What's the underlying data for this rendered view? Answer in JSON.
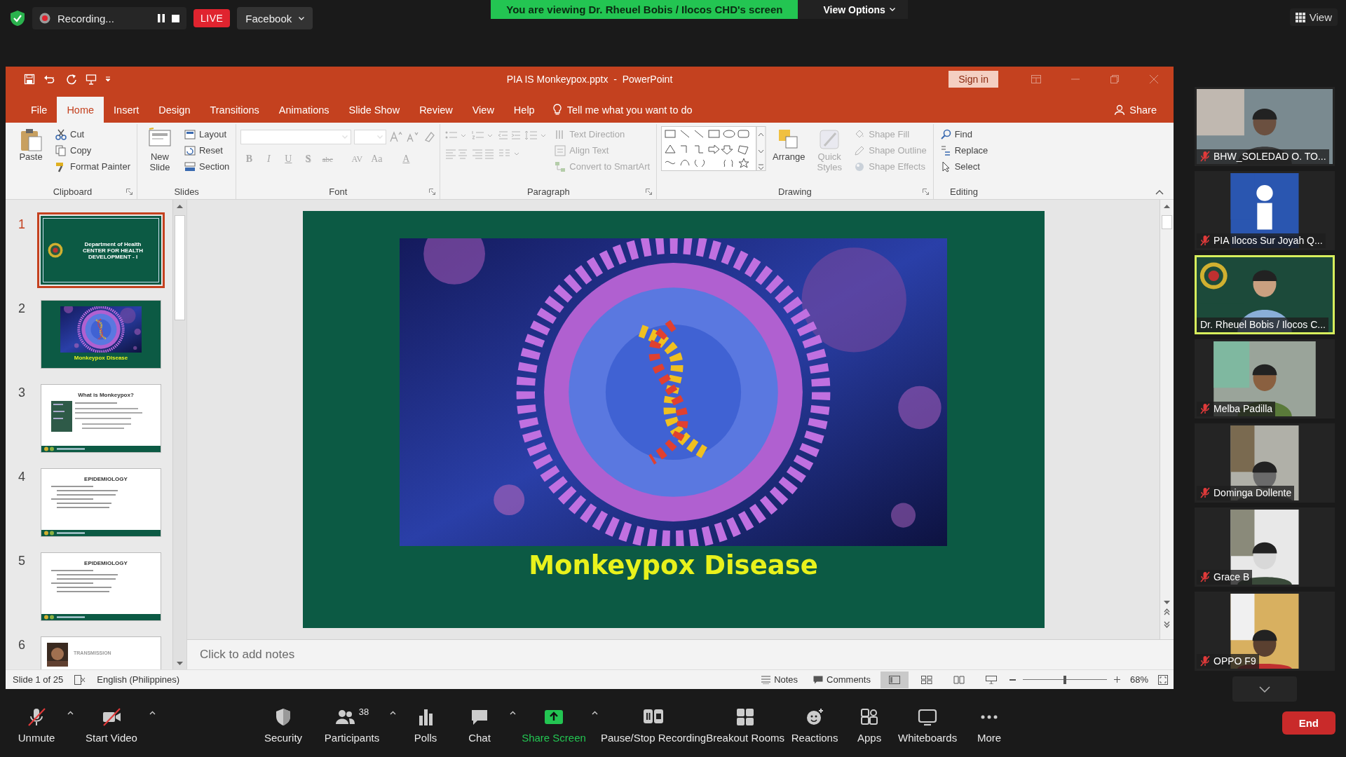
{
  "meeting_bar": {
    "recording": "Recording...",
    "live_badge": "LIVE",
    "stream_target": "Facebook",
    "banner": "You are viewing Dr. Rheuel Bobis / Ilocos CHD's screen",
    "view_options": "View Options",
    "view_button": "View"
  },
  "powerpoint": {
    "title": "PIA IS Monkeypox.pptx  -  PowerPoint",
    "sign_in": "Sign in",
    "tabs": [
      {
        "label": "File",
        "selected": false
      },
      {
        "label": "Home",
        "selected": true
      },
      {
        "label": "Insert",
        "selected": false
      },
      {
        "label": "Design",
        "selected": false
      },
      {
        "label": "Transitions",
        "selected": false
      },
      {
        "label": "Animations",
        "selected": false
      },
      {
        "label": "Slide Show",
        "selected": false
      },
      {
        "label": "Review",
        "selected": false
      },
      {
        "label": "View",
        "selected": false
      },
      {
        "label": "Help",
        "selected": false
      }
    ],
    "tell_me": "Tell me what you want to do",
    "share": "Share",
    "ribbon_groups": [
      {
        "label": "Clipboard",
        "launcher": true,
        "items": [
          {
            "label": "Paste",
            "kind": "large",
            "disabled": false
          },
          {
            "label": "Cut",
            "kind": "small",
            "disabled": false
          },
          {
            "label": "Copy",
            "kind": "small",
            "disabled": false
          },
          {
            "label": "Format Painter",
            "kind": "small",
            "disabled": false
          }
        ]
      },
      {
        "label": "Slides",
        "launcher": false,
        "items": [
          {
            "label": "New Slide",
            "kind": "large",
            "disabled": false
          },
          {
            "label": "Layout",
            "kind": "small",
            "disabled": false
          },
          {
            "label": "Reset",
            "kind": "small",
            "disabled": false
          },
          {
            "label": "Section",
            "kind": "small",
            "disabled": false
          }
        ]
      },
      {
        "label": "Font",
        "launcher": true,
        "items": [
          {
            "kind": "field",
            "disabled": true
          },
          {
            "kind": "field",
            "disabled": true
          },
          {
            "label": "B",
            "kind": "glyph",
            "disabled": true
          },
          {
            "label": "I",
            "kind": "glyph",
            "disabled": true
          },
          {
            "label": "U",
            "kind": "glyph",
            "disabled": true
          },
          {
            "label": "S",
            "kind": "glyph",
            "disabled": true
          },
          {
            "label": "abc",
            "kind": "glyph",
            "disabled": true
          },
          {
            "label": "AV",
            "kind": "glyph",
            "disabled": true
          },
          {
            "label": "Aa",
            "kind": "glyph",
            "disabled": true
          },
          {
            "label": "A",
            "kind": "glyph",
            "disabled": true
          }
        ]
      },
      {
        "label": "Paragraph",
        "launcher": true,
        "items": [
          {
            "label": "Text Direction",
            "kind": "small",
            "disabled": true
          },
          {
            "label": "Align Text",
            "kind": "small",
            "disabled": true
          },
          {
            "label": "Convert to SmartArt",
            "kind": "small",
            "disabled": true
          }
        ]
      },
      {
        "label": "Drawing",
        "launcher": true,
        "items": [
          {
            "label": "Arrange",
            "kind": "large",
            "disabled": false
          },
          {
            "label": "Quick Styles",
            "kind": "large",
            "disabled": true
          },
          {
            "label": "Shape Fill",
            "kind": "small",
            "disabled": true
          },
          {
            "label": "Shape Outline",
            "kind": "small",
            "disabled": true
          },
          {
            "label": "Shape Effects",
            "kind": "small",
            "disabled": true
          }
        ]
      },
      {
        "label": "Editing",
        "launcher": false,
        "items": [
          {
            "label": "Find",
            "kind": "small",
            "disabled": false
          },
          {
            "label": "Replace",
            "kind": "small",
            "disabled": false
          },
          {
            "label": "Select",
            "kind": "small",
            "disabled": false
          }
        ]
      }
    ],
    "thumbnails": [
      {
        "number": "1",
        "selected": true,
        "kind": "title",
        "lines": [
          "Department of Health",
          "CENTER FOR HEALTH DEVELOPMENT - I"
        ]
      },
      {
        "number": "2",
        "selected": false,
        "kind": "picture",
        "lines": [
          "Monkeypox Disease"
        ]
      },
      {
        "number": "3",
        "selected": false,
        "kind": "content",
        "lines": [
          "What is Monkeypox?"
        ]
      },
      {
        "number": "4",
        "selected": false,
        "kind": "bullets",
        "lines": [
          "EPIDEMIOLOGY"
        ]
      },
      {
        "number": "5",
        "selected": false,
        "kind": "bullets",
        "lines": [
          "EPIDEMIOLOGY"
        ]
      },
      {
        "number": "6",
        "selected": false,
        "kind": "diagram",
        "lines": [
          "TRANSMISSION"
        ]
      }
    ],
    "slide": {
      "title": "Monkeypox Disease"
    },
    "notes": {
      "placeholder": "Click to add notes"
    },
    "status_bar": {
      "slide_position": "Slide 1 of 25",
      "language": "English (Philippines)",
      "notes": "Notes",
      "comments": "Comments",
      "views": [
        {
          "selected": true
        },
        {
          "selected": false
        },
        {
          "selected": false
        },
        {
          "selected": false
        }
      ],
      "zoom": {
        "level": 0.5,
        "reading": "68%"
      }
    }
  },
  "gallery": [
    {
      "name": "BHW_SOLEDAD O. TO...",
      "muted": true,
      "selected": false
    },
    {
      "name": "PIA Ilocos Sur Joyah Q...",
      "muted": true,
      "selected": false
    },
    {
      "name": "Dr. Rheuel Bobis / Ilocos C...",
      "muted": false,
      "selected": true
    },
    {
      "name": "Melba Padilla",
      "muted": true,
      "selected": false
    },
    {
      "name": "Dominga Dollente",
      "muted": true,
      "selected": false
    },
    {
      "name": "Grace B",
      "muted": true,
      "selected": false
    },
    {
      "name": "OPPO F9",
      "muted": true,
      "selected": false
    }
  ],
  "toolbar": {
    "items": [
      {
        "label": "Unmute",
        "kind": "button",
        "off": true,
        "menu": true
      },
      {
        "label": "Start Video",
        "kind": "button",
        "off": true,
        "menu": true
      },
      {
        "label": "Security",
        "kind": "button",
        "off": false,
        "menu": false
      },
      {
        "label": "Participants",
        "kind": "button",
        "off": false,
        "menu": true,
        "count": "38"
      },
      {
        "label": "Polls",
        "kind": "button",
        "off": false,
        "menu": false
      },
      {
        "label": "Chat",
        "kind": "button",
        "off": false,
        "menu": true
      },
      {
        "label": "Share Screen",
        "kind": "share",
        "off": false,
        "menu": true
      },
      {
        "label": "Pause/Stop Recording",
        "kind": "button",
        "off": false,
        "menu": false
      },
      {
        "label": "Breakout Rooms",
        "kind": "button",
        "off": false,
        "menu": false
      },
      {
        "label": "Reactions",
        "kind": "button",
        "off": false,
        "menu": false
      },
      {
        "label": "Apps",
        "kind": "button",
        "off": false,
        "menu": false
      },
      {
        "label": "Whiteboards",
        "kind": "button",
        "off": false,
        "menu": false
      },
      {
        "label": "More",
        "kind": "button",
        "off": false,
        "menu": false
      }
    ],
    "end_button": "End"
  }
}
